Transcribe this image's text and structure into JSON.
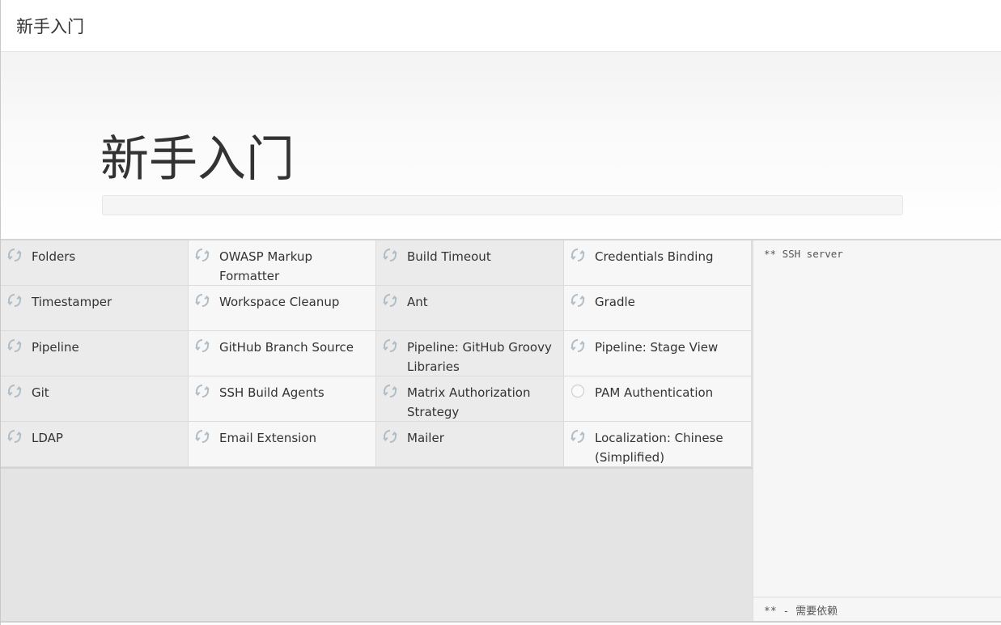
{
  "header": {
    "title": "新手入门"
  },
  "hero": {
    "title": "新手入门",
    "progress_percent": 0
  },
  "plugins": [
    {
      "name": "Folders",
      "status": "installing",
      "icon": "refresh-icon"
    },
    {
      "name": "OWASP Markup Formatter",
      "status": "installing",
      "icon": "refresh-icon"
    },
    {
      "name": "Build Timeout",
      "status": "installing",
      "icon": "refresh-icon"
    },
    {
      "name": "Credentials Binding",
      "status": "installing",
      "icon": "refresh-icon"
    },
    {
      "name": "Timestamper",
      "status": "installing",
      "icon": "refresh-icon"
    },
    {
      "name": "Workspace Cleanup",
      "status": "installing",
      "icon": "refresh-icon"
    },
    {
      "name": "Ant",
      "status": "installing",
      "icon": "refresh-icon"
    },
    {
      "name": "Gradle",
      "status": "installing",
      "icon": "refresh-icon"
    },
    {
      "name": "Pipeline",
      "status": "installing",
      "icon": "refresh-icon"
    },
    {
      "name": "GitHub Branch Source",
      "status": "installing",
      "icon": "refresh-icon"
    },
    {
      "name": "Pipeline: GitHub Groovy Libraries",
      "status": "installing",
      "icon": "refresh-icon"
    },
    {
      "name": "Pipeline: Stage View",
      "status": "installing",
      "icon": "refresh-icon"
    },
    {
      "name": "Git",
      "status": "installing",
      "icon": "refresh-icon"
    },
    {
      "name": "SSH Build Agents",
      "status": "installing",
      "icon": "refresh-icon"
    },
    {
      "name": "Matrix Authorization Strategy",
      "status": "installing",
      "icon": "refresh-icon"
    },
    {
      "name": "PAM Authentication",
      "status": "pending",
      "icon": "circle-icon"
    },
    {
      "name": "LDAP",
      "status": "installing",
      "icon": "refresh-icon"
    },
    {
      "name": "Email Extension",
      "status": "installing",
      "icon": "refresh-icon"
    },
    {
      "name": "Mailer",
      "status": "installing",
      "icon": "refresh-icon"
    },
    {
      "name": "Localization: Chinese (Simplified)",
      "status": "installing",
      "icon": "refresh-icon"
    }
  ],
  "log": {
    "text": "** SSH server",
    "footer": "** - 需要依赖"
  },
  "colors": {
    "icon": "#b0bcc6",
    "cell_dark": "#ebebeb",
    "cell_light": "#f7f7f7"
  }
}
